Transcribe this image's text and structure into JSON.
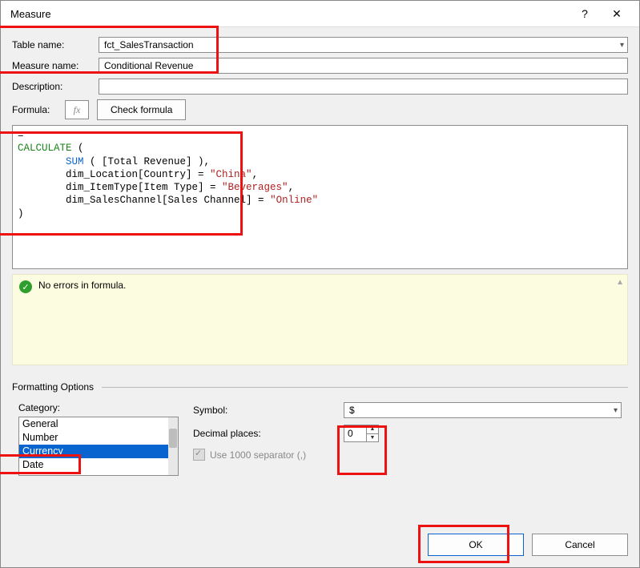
{
  "titlebar": {
    "title": "Measure",
    "help_symbol": "?",
    "close_symbol": "✕"
  },
  "fields": {
    "table_name_label": "Table name:",
    "table_name_value": "fct_SalesTransaction",
    "measure_name_label": "Measure name:",
    "measure_name_value": "Conditional Revenue",
    "description_label": "Description:",
    "description_value": "",
    "formula_label": "Formula:",
    "fx_label": "fx",
    "check_formula_label": "Check formula"
  },
  "formula": {
    "eq": "=",
    "calc": "CALCULATE",
    "open": " ( ",
    "sum": "SUM",
    "sum_args": " ( [Total Revenue] ),",
    "line3_pre": "        dim_Location[Country] = ",
    "line3_str": "\"China\"",
    "line3_post": ",",
    "line4_pre": "        dim_ItemType[Item Type] = ",
    "line4_str": "\"Beverages\"",
    "line4_post": ",",
    "line5_pre": "        dim_SalesChannel[Sales Channel] = ",
    "line5_str": "\"Online\"",
    "close": ")"
  },
  "status": {
    "message": "No errors in formula."
  },
  "format": {
    "section_title": "Formatting Options",
    "category_label": "Category:",
    "categories": {
      "c0": "General",
      "c1": "Number",
      "c2": "Currency",
      "c3": "Date"
    },
    "symbol_label": "Symbol:",
    "symbol_value": "$",
    "decimal_label": "Decimal places:",
    "decimal_value": "0",
    "separator_label": "Use 1000 separator (,)"
  },
  "footer": {
    "ok_label": "OK",
    "cancel_label": "Cancel"
  }
}
